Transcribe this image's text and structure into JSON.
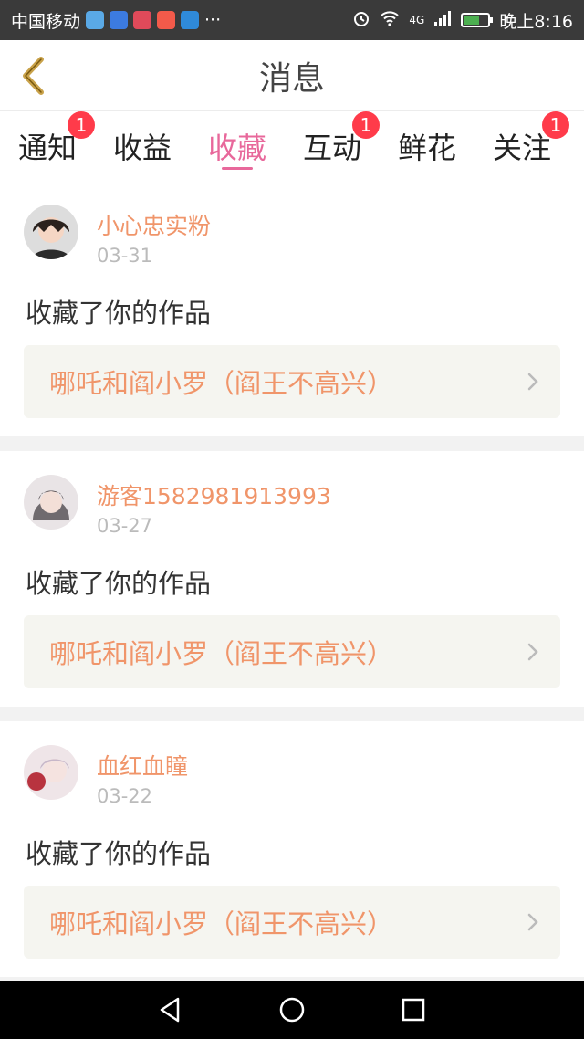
{
  "status_bar": {
    "carrier": "中国移动",
    "more": "···",
    "network": "4G",
    "time": "晚上8:16"
  },
  "header": {
    "title": "消息"
  },
  "tabs": [
    {
      "label": "通知",
      "badge": "1"
    },
    {
      "label": "收益",
      "badge": ""
    },
    {
      "label": "收藏",
      "badge": "",
      "active": true
    },
    {
      "label": "互动",
      "badge": "1"
    },
    {
      "label": "鲜花",
      "badge": ""
    },
    {
      "label": "关注",
      "badge": "1"
    }
  ],
  "messages": [
    {
      "user": "小心忠实粉",
      "date": "03-31",
      "text": "收藏了你的作品",
      "work": "哪吒和阎小罗（阎王不高兴）"
    },
    {
      "user": "游客1582981913993",
      "date": "03-27",
      "text": "收藏了你的作品",
      "work": "哪吒和阎小罗（阎王不高兴）"
    },
    {
      "user": "血红血瞳",
      "date": "03-22",
      "text": "收藏了你的作品",
      "work": "哪吒和阎小罗（阎王不高兴）"
    }
  ],
  "colors": {
    "accent": "#e8689b",
    "username": "#f0956a",
    "badge": "#ff3b4a",
    "back_icon": "#c9a24a"
  },
  "icons": {
    "back": "chevron-left-icon",
    "item_arrow": "chevron-right-icon",
    "nav_back": "triangle-back-icon",
    "nav_home": "circle-home-icon",
    "nav_recent": "square-recent-icon"
  }
}
